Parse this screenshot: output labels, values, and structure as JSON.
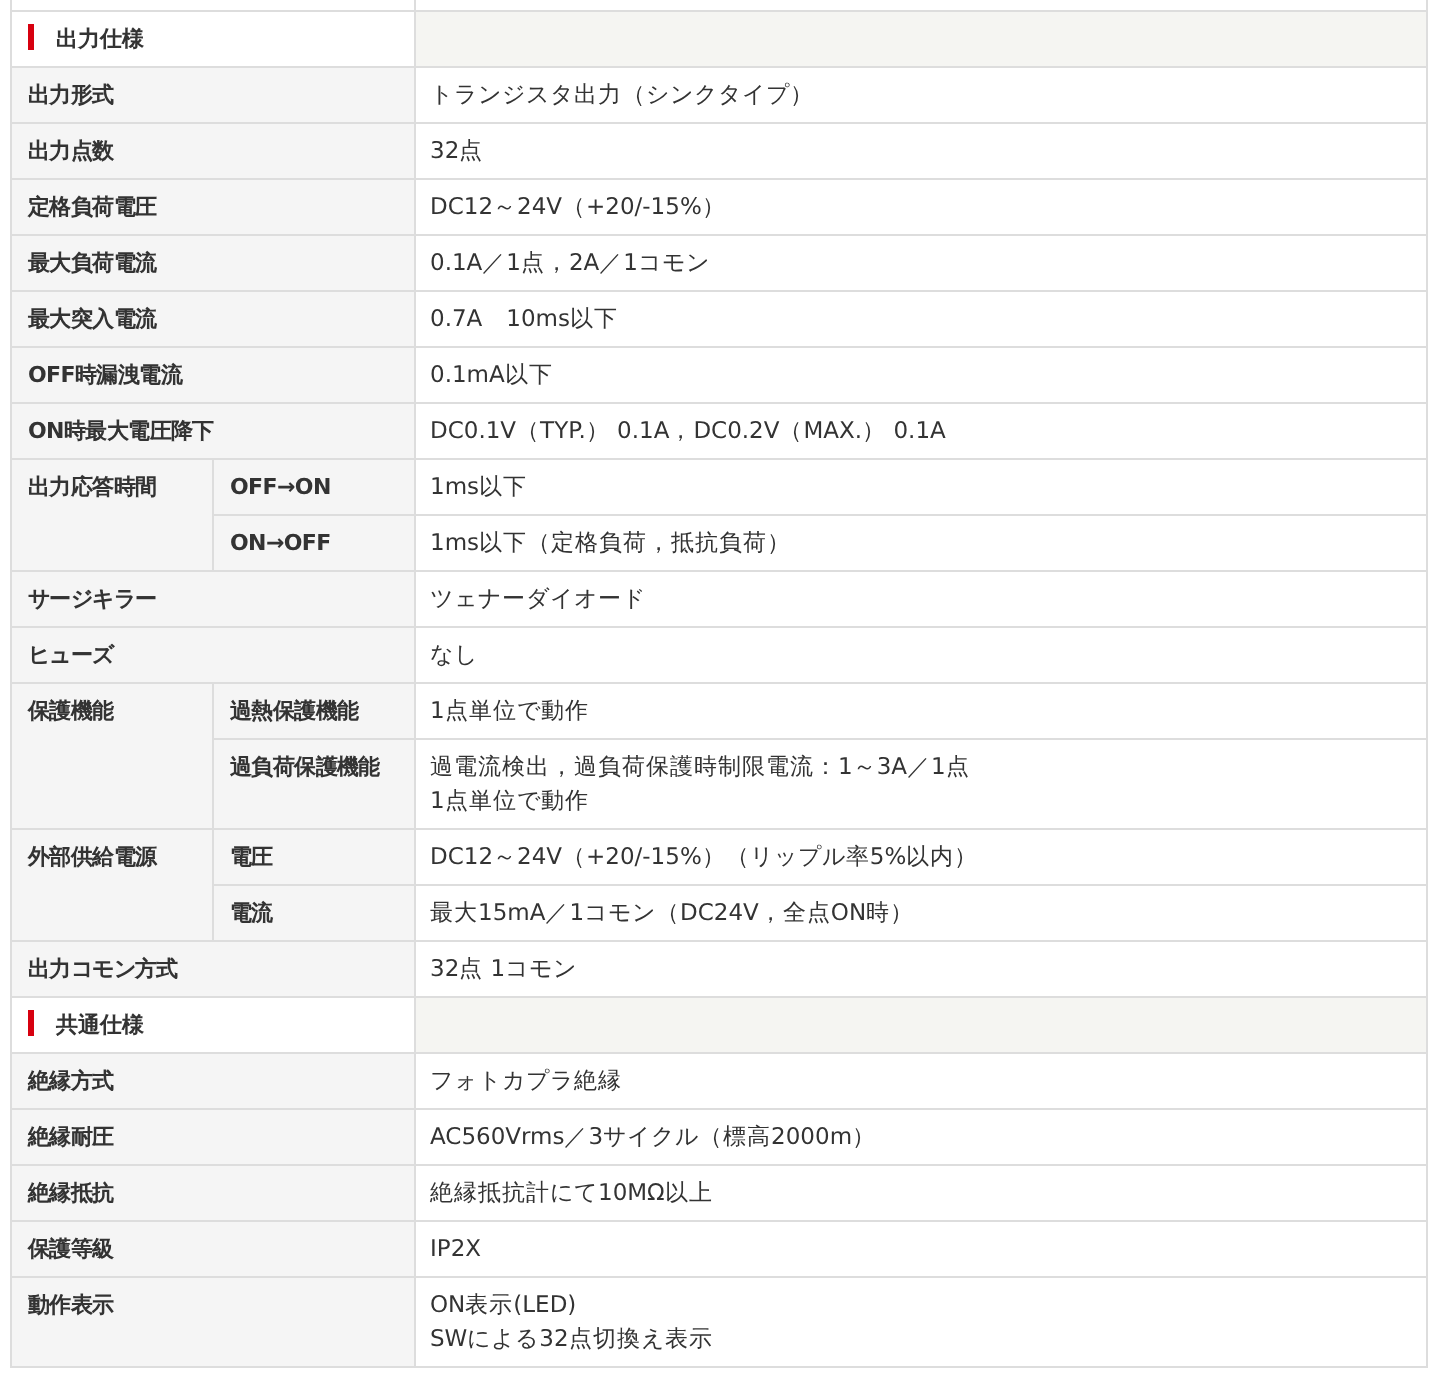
{
  "sections": [
    {
      "title": "出力仕様",
      "rows": [
        {
          "label": "出力形式",
          "value": [
            "トランジスタ出力（シンクタイプ）"
          ]
        },
        {
          "label": "出力点数",
          "value": [
            "32点"
          ]
        },
        {
          "label": "定格負荷電圧",
          "value": [
            "DC12～24V（+20/-15%）"
          ]
        },
        {
          "label": "最大負荷電流",
          "value": [
            "0.1A／1点，2A／1コモン"
          ]
        },
        {
          "label": "最大突入電流",
          "value": [
            "0.7A　10ms以下"
          ]
        },
        {
          "label": "OFF時漏洩電流",
          "value": [
            "0.1mA以下"
          ]
        },
        {
          "label": "ON時最大電圧降下",
          "value": [
            "DC0.1V（TYP.） 0.1A，DC0.2V（MAX.） 0.1A"
          ]
        },
        {
          "label": "出力応答時間",
          "sub": [
            {
              "label": "OFF→ON",
              "value": [
                "1ms以下"
              ]
            },
            {
              "label": "ON→OFF",
              "value": [
                "1ms以下（定格負荷，抵抗負荷）"
              ]
            }
          ]
        },
        {
          "label": "サージキラー",
          "value": [
            "ツェナーダイオード"
          ]
        },
        {
          "label": "ヒューズ",
          "value": [
            "なし"
          ]
        },
        {
          "label": "保護機能",
          "sub": [
            {
              "label": "過熱保護機能",
              "value": [
                "1点単位で動作"
              ]
            },
            {
              "label": "過負荷保護機能",
              "value": [
                "過電流検出，過負荷保護時制限電流：1～3A／1点",
                "1点単位で動作"
              ]
            }
          ]
        },
        {
          "label": "外部供給電源",
          "sub": [
            {
              "label": "電圧",
              "value": [
                "DC12～24V（+20/-15%）（リップル率5%以内）"
              ]
            },
            {
              "label": "電流",
              "value": [
                "最大15mA／1コモン（DC24V，全点ON時）"
              ]
            }
          ]
        },
        {
          "label": "出力コモン方式",
          "value": [
            "32点 1コモン"
          ]
        }
      ]
    },
    {
      "title": "共通仕様",
      "rows": [
        {
          "label": "絶縁方式",
          "value": [
            "フォトカプラ絶縁"
          ]
        },
        {
          "label": "絶縁耐圧",
          "value": [
            "AC560Vrms／3サイクル（標高2000m）"
          ]
        },
        {
          "label": "絶縁抵抗",
          "value": [
            "絶縁抵抗計にて10MΩ以上"
          ]
        },
        {
          "label": "保護等級",
          "value": [
            "IP2X"
          ]
        },
        {
          "label": "動作表示",
          "value": [
            "ON表示(LED)",
            "SWによる32点切換え表示"
          ]
        }
      ]
    }
  ]
}
